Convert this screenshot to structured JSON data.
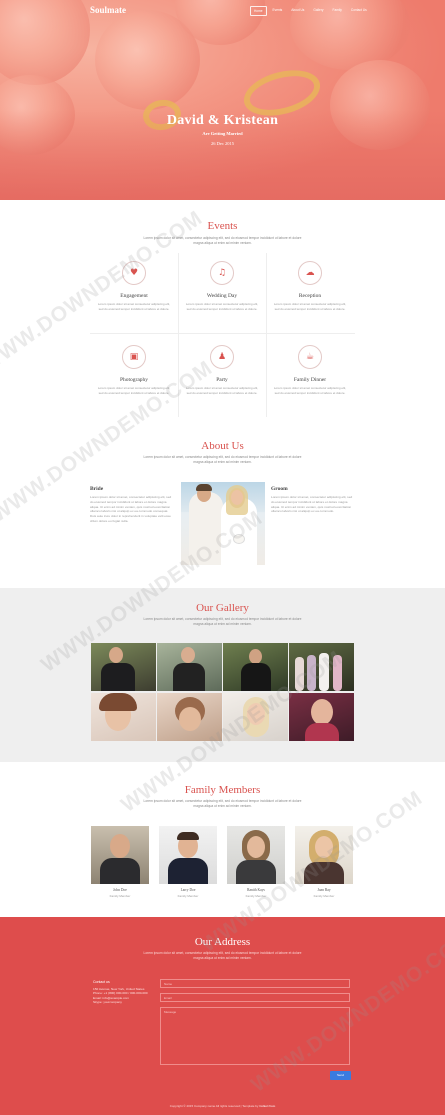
{
  "header": {
    "brand": "Soulmate",
    "nav": [
      "Home",
      "Events",
      "About Us",
      "Gallery",
      "Family",
      "Contact Us"
    ],
    "active_index": 0,
    "title": "David & Kristean",
    "subtitle": "Are Getting Married",
    "date": "26 Dec 2015"
  },
  "events": {
    "title": "Events",
    "intro": "Lorem ipsum dolor sit amet, consectetur adipiscing elit, sed do eiusmod tempor incididunt ut labore et dolore magna aliqua ut enim ad minim veniam.",
    "items": [
      {
        "icon": "heart-icon",
        "glyph": "♥",
        "title": "Engagement",
        "desc": "Lorem ipsum dolor sit amet consectetur adipiscing elit, sed do eiusmod tempor incididunt ut labore et dolore."
      },
      {
        "icon": "music-icon",
        "glyph": "♫",
        "title": "Wedding Day",
        "desc": "Lorem ipsum dolor sit amet consectetur adipiscing elit, sed do eiusmod tempor incididunt ut labore et dolore."
      },
      {
        "icon": "cloud-icon",
        "glyph": "☁",
        "title": "Reception",
        "desc": "Lorem ipsum dolor sit amet consectetur adipiscing elit, sed do eiusmod tempor incididunt ut labore et dolore."
      },
      {
        "icon": "camera-icon",
        "glyph": "▣",
        "title": "Photography",
        "desc": "Lorem ipsum dolor sit amet consectetur adipiscing elit, sed do eiusmod tempor incididunt ut labore et dolore."
      },
      {
        "icon": "party-icon",
        "glyph": "♟",
        "title": "Party",
        "desc": "Lorem ipsum dolor sit amet consectetur adipiscing elit, sed do eiusmod tempor incididunt ut labore et dolore."
      },
      {
        "icon": "dinner-icon",
        "glyph": "☕",
        "title": "Family Dinner",
        "desc": "Lorem ipsum dolor sit amet consectetur adipiscing elit, sed do eiusmod tempor incididunt ut labore et dolore."
      }
    ]
  },
  "about": {
    "title": "About Us",
    "intro": "Lorem ipsum dolor sit amet, consectetur adipiscing elit, sed do eiusmod tempor incididunt ut labore et dolore magna aliqua ut enim ad minim veniam.",
    "bride_title": "Bride",
    "bride_text": "Lorem ipsum dolor sit amet, consectetur adipiscing elit, sed do eiusmod tempor incididunt ut labore et dolore magna aliqua. Ut enim ad minim veniam, quis nostrud exercitation ullamco laboris nisi ut aliquip ex ea commodo consequat. Duis aute irure dolor in reprehenderit in voluptate velit esse cillum dolore eu fugiat nulla.",
    "groom_title": "Groom",
    "groom_text": "Lorem ipsum dolor sit amet, consectetur adipiscing elit, sed do eiusmod tempor incididunt ut labore et dolore magna aliqua. Ut enim ad minim veniam, quis nostrud exercitation ullamco laboris nisi ut aliquip ex ea commodo."
  },
  "gallery": {
    "title": "Our Gallery",
    "intro": "Lorem ipsum dolor sit amet, consectetur adipiscing elit, sed do eiusmod tempor incididunt ut labore et dolore magna aliqua ut enim ad minim veniam."
  },
  "family": {
    "title": "Family Members",
    "intro": "Lorem ipsum dolor sit amet, consectetur adipiscing elit, sed do eiusmod tempor incididunt ut labore et dolore magna aliqua ut enim ad minim veniam.",
    "members": [
      {
        "name": "John Doe",
        "role": "Family Member"
      },
      {
        "name": "Larry Doe",
        "role": "Family Member"
      },
      {
        "name": "Ranith Kays",
        "role": "Family Member"
      },
      {
        "name": "Joan Ray",
        "role": "Family Member"
      }
    ]
  },
  "address": {
    "title": "Our Address",
    "intro": "Lorem ipsum dolor sit amet, consectetur adipiscing elit, sed do eiusmod tempor incididunt ut labore et dolore magna aliqua ut enim ad minim veniam.",
    "contact_label": "Contact us",
    "lines": [
      "150 Avenue, New York, United States",
      "Phone: +1 (800) 000-000 / 000-000-000",
      "Email: info@example.com",
      "Skype: yourcompany"
    ],
    "name_placeholder": "Name",
    "email_placeholder": "Email",
    "message_placeholder": "Message",
    "send_label": "Send"
  },
  "footer": {
    "text": "Copyright © 2015 Company name All rights reserved | Template by",
    "link": "Collect from"
  },
  "watermark": "WWW.DOWNDEMO.COM",
  "colors": {
    "accent": "#d9534f",
    "address_bg": "#de4d4c",
    "button": "#3a7be0",
    "gallery_bg": "#efefef"
  }
}
